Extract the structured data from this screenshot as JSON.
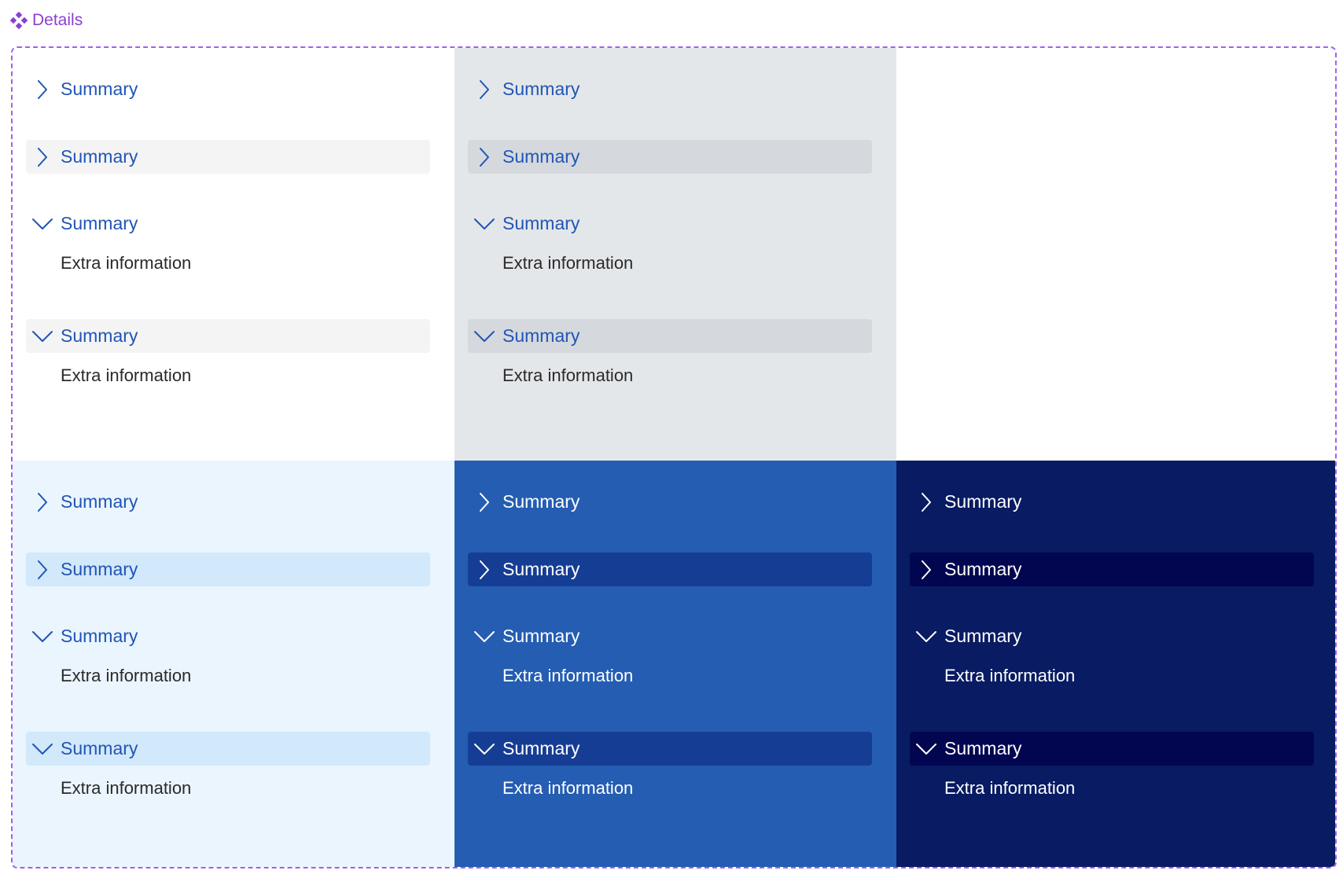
{
  "component": {
    "icon": "component-diamond-icon",
    "title": "Details"
  },
  "colors": {
    "frame_border": "#a45df0",
    "title": "#8a3fd4",
    "link_blue": "#2155b6"
  },
  "cells": [
    {
      "id": "white",
      "background": "#ffffff",
      "highlight": "#f4f4f4",
      "theme": "light",
      "items": [
        {
          "state": "collapsed",
          "highlighted": false,
          "summary": "Summary"
        },
        {
          "state": "collapsed",
          "highlighted": true,
          "summary": "Summary"
        },
        {
          "state": "expanded",
          "highlighted": false,
          "summary": "Summary",
          "extra": "Extra information"
        },
        {
          "state": "expanded",
          "highlighted": true,
          "summary": "Summary",
          "extra": "Extra information"
        }
      ]
    },
    {
      "id": "grey",
      "background": "#e4e7ea",
      "highlight": "#d5d9dd",
      "theme": "light",
      "items": [
        {
          "state": "collapsed",
          "highlighted": false,
          "summary": "Summary"
        },
        {
          "state": "collapsed",
          "highlighted": true,
          "summary": "Summary"
        },
        {
          "state": "expanded",
          "highlighted": false,
          "summary": "Summary",
          "extra": "Extra information"
        },
        {
          "state": "expanded",
          "highlighted": true,
          "summary": "Summary",
          "extra": "Extra information"
        }
      ]
    },
    {
      "id": "light-blue",
      "background": "#eaf5fd",
      "highlight": "#d2e8fb",
      "theme": "light",
      "items": [
        {
          "state": "collapsed",
          "highlighted": false,
          "summary": "Summary"
        },
        {
          "state": "collapsed",
          "highlighted": true,
          "summary": "Summary"
        },
        {
          "state": "expanded",
          "highlighted": false,
          "summary": "Summary",
          "extra": "Extra information"
        },
        {
          "state": "expanded",
          "highlighted": true,
          "summary": "Summary",
          "extra": "Extra information"
        }
      ]
    },
    {
      "id": "blue",
      "background": "#245db2",
      "highlight": "#163d94",
      "theme": "dark",
      "items": [
        {
          "state": "collapsed",
          "highlighted": false,
          "summary": "Summary"
        },
        {
          "state": "collapsed",
          "highlighted": true,
          "summary": "Summary"
        },
        {
          "state": "expanded",
          "highlighted": false,
          "summary": "Summary",
          "extra": "Extra information"
        },
        {
          "state": "expanded",
          "highlighted": true,
          "summary": "Summary",
          "extra": "Extra information"
        }
      ]
    },
    {
      "id": "navy",
      "background": "#081b63",
      "highlight": "#020651",
      "theme": "dark",
      "items": [
        {
          "state": "collapsed",
          "highlighted": false,
          "summary": "Summary"
        },
        {
          "state": "collapsed",
          "highlighted": true,
          "summary": "Summary"
        },
        {
          "state": "expanded",
          "highlighted": false,
          "summary": "Summary",
          "extra": "Extra information"
        },
        {
          "state": "expanded",
          "highlighted": true,
          "summary": "Summary",
          "extra": "Extra information"
        }
      ]
    }
  ]
}
